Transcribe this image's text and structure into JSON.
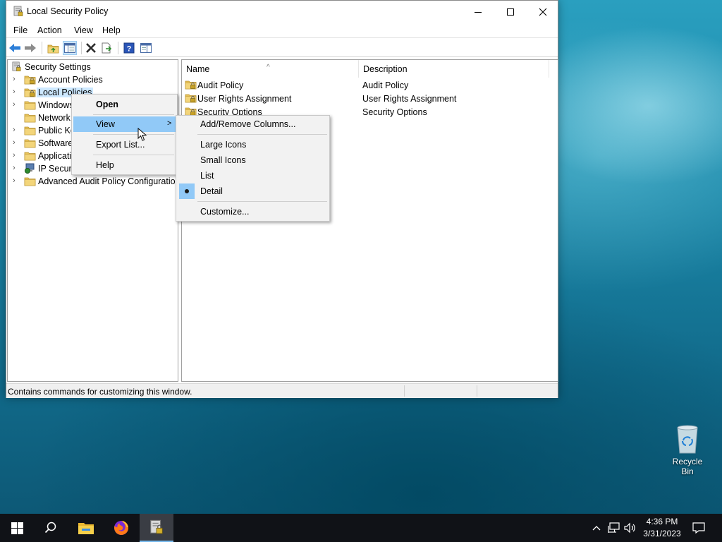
{
  "window": {
    "title": "Local Security Policy",
    "menu": [
      "File",
      "Action",
      "View",
      "Help"
    ],
    "tree": {
      "root": "Security Settings",
      "items": [
        "Account Policies",
        "Local Policies",
        "Windows",
        "Network",
        "Public Ke",
        "Software",
        "Applicati",
        "IP Securi",
        "Advanced Audit Policy Configuration"
      ]
    },
    "list": {
      "columns": [
        "Name",
        "Description"
      ],
      "rows": [
        {
          "name": "Audit Policy",
          "description": "Audit Policy"
        },
        {
          "name": "User Rights Assignment",
          "description": "User Rights Assignment"
        },
        {
          "name": "Security Options",
          "description": "Security Options"
        }
      ]
    },
    "status": "Contains commands for customizing this window."
  },
  "context_menu": {
    "items": [
      "Open",
      "View",
      "Export List...",
      "Help"
    ],
    "submenu_arrow": ">"
  },
  "view_submenu": {
    "items": [
      "Add/Remove Columns...",
      "Large Icons",
      "Small Icons",
      "List",
      "Detail",
      "Customize..."
    ],
    "selected": "Detail"
  },
  "desktop": {
    "recycle_bin": "Recycle Bin"
  },
  "taskbar": {
    "time": "4:36 PM",
    "date": "3/31/2023"
  },
  "colors": {
    "menu_highlight": "#91c9f7",
    "selection": "#cde8ff",
    "taskbar": "#101217",
    "folder": "#e8c35a"
  }
}
